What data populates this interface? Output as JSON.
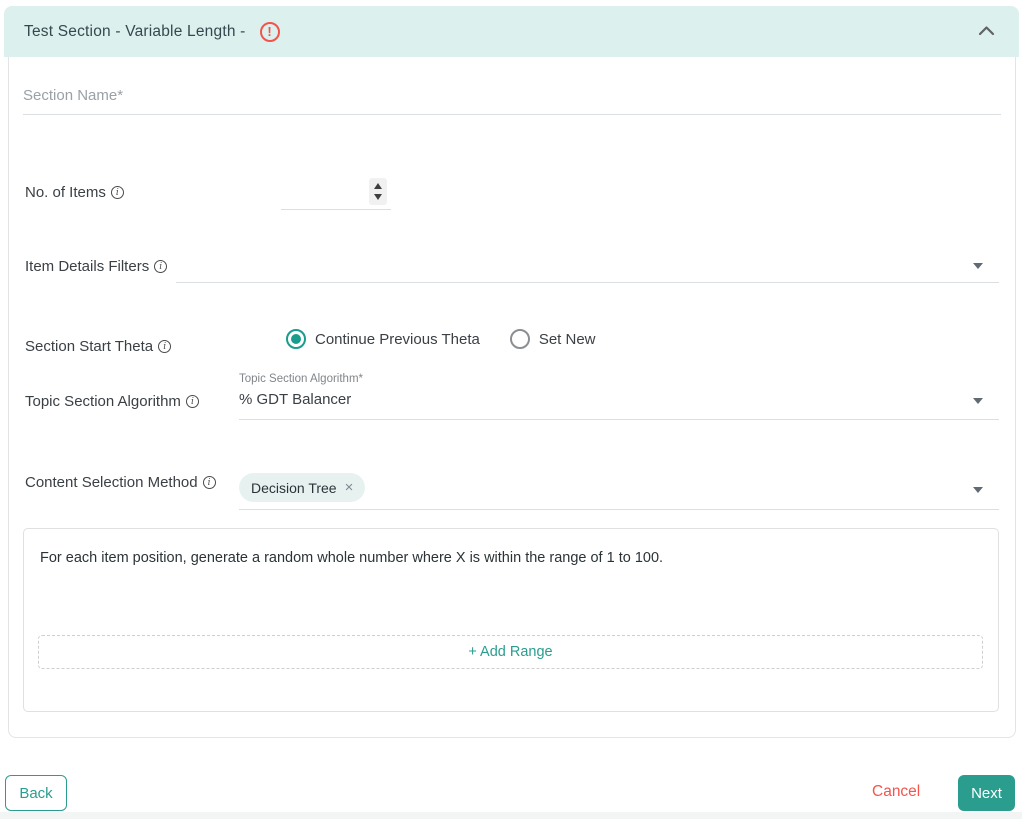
{
  "panel": {
    "title": "Test Section - Variable Length -",
    "error_icon": "!",
    "collapse_icon": "chevron-up"
  },
  "form": {
    "section_name": {
      "placeholder": "Section Name*",
      "value": ""
    },
    "no_of_items": {
      "label": "No. of Items",
      "value": ""
    },
    "item_details_filters": {
      "label": "Item Details Filters",
      "value": ""
    },
    "section_start_theta": {
      "label": "Section Start Theta",
      "options": [
        {
          "label": "Continue Previous Theta",
          "selected": true
        },
        {
          "label": "Set New",
          "selected": false
        }
      ]
    },
    "topic_section_algorithm": {
      "label": "Topic Section Algorithm",
      "field_label": "Topic Section Algorithm*",
      "value": "% GDT Balancer"
    },
    "content_selection_method": {
      "label": "Content Selection Method",
      "chips": [
        {
          "label": "Decision Tree",
          "remove_icon": "×"
        }
      ]
    },
    "range_box": {
      "description": "For each item position, generate a random whole number where X is within the range of 1 to 100.",
      "add_button": "+ Add Range"
    }
  },
  "footer": {
    "back": "Back",
    "cancel": "Cancel",
    "next": "Next"
  },
  "colors": {
    "accent_teal": "#2a9d8f",
    "header_bg": "#dcf0ee",
    "error_red": "#f2544c",
    "chip_bg": "#e7f2f0"
  }
}
